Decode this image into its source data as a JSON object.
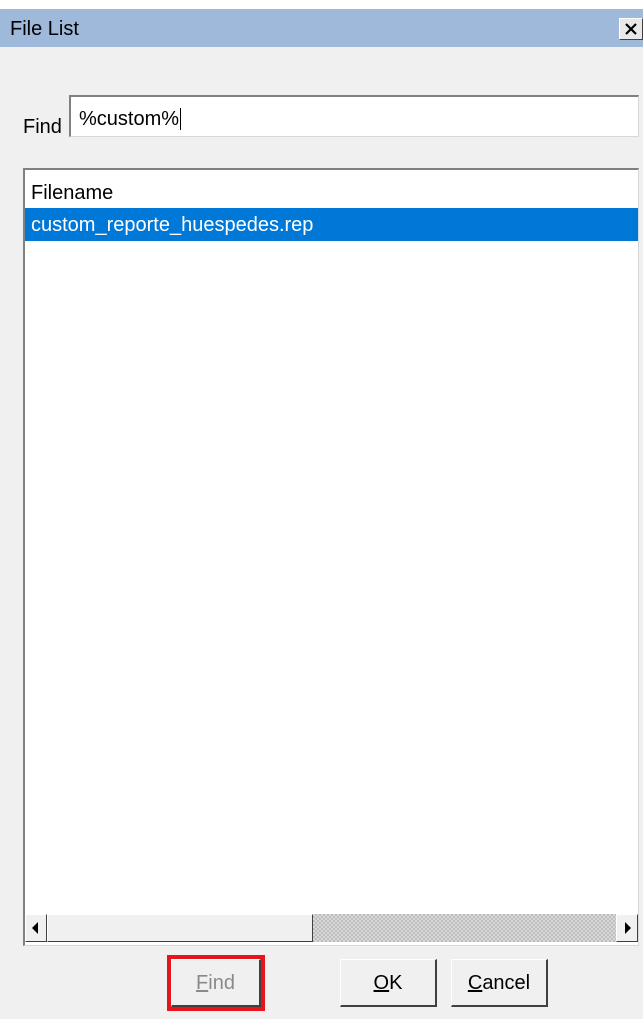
{
  "window": {
    "title": "File List",
    "close_icon": "close-icon"
  },
  "search": {
    "label": "Find",
    "value": "%custom%"
  },
  "file_list": {
    "column_header": "Filename",
    "rows": [
      {
        "filename": "custom_reporte_huespedes.rep",
        "selected": true
      }
    ],
    "selection_color": "#0078d7"
  },
  "scrollbar": {
    "left_icon": "arrow-left-icon",
    "right_icon": "arrow-right-icon"
  },
  "buttons": {
    "find": {
      "mnemonic": "F",
      "rest": "ind",
      "enabled": false
    },
    "ok": {
      "mnemonic": "O",
      "rest": "K"
    },
    "cancel": {
      "mnemonic": "C",
      "rest": "ancel"
    }
  },
  "highlight_color": "#e8141c"
}
